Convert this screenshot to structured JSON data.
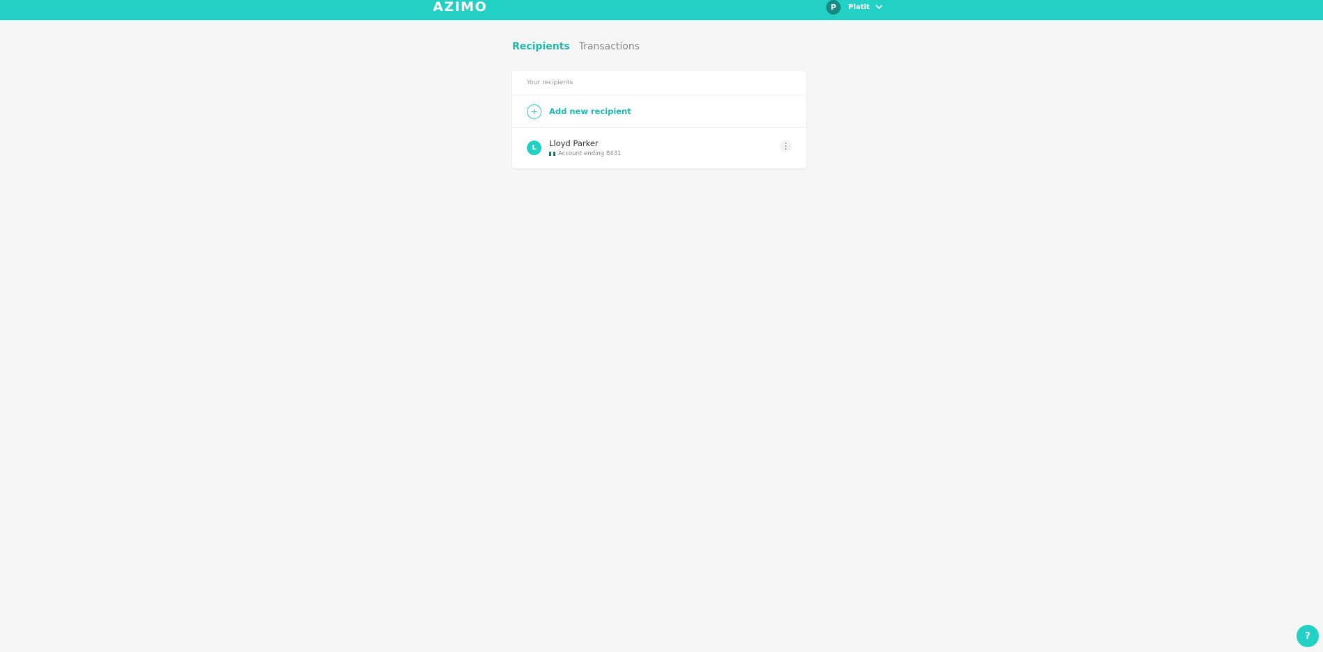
{
  "header": {
    "logo_text": "AZIMO",
    "user_initial": "P",
    "user_name": "Platit",
    "brand_color": "#22d0c4",
    "chevron_icon": "chevron-down-icon"
  },
  "tabs": [
    {
      "label": "Recipients",
      "active": true
    },
    {
      "label": "Transactions",
      "active": false
    }
  ],
  "recipients_card": {
    "header_label": "Your recipients",
    "add_label": "Add new recipient",
    "add_icon": "plus-circle-icon",
    "recipients": [
      {
        "initial": "L",
        "name": "Lloyd Parker",
        "account": "Account ending 8431",
        "flag_colors": [
          "#008751",
          "#ffffff",
          "#008751"
        ],
        "menu_icon": "more-vertical-icon"
      }
    ]
  },
  "help": {
    "label": "?",
    "icon": "help-icon"
  }
}
